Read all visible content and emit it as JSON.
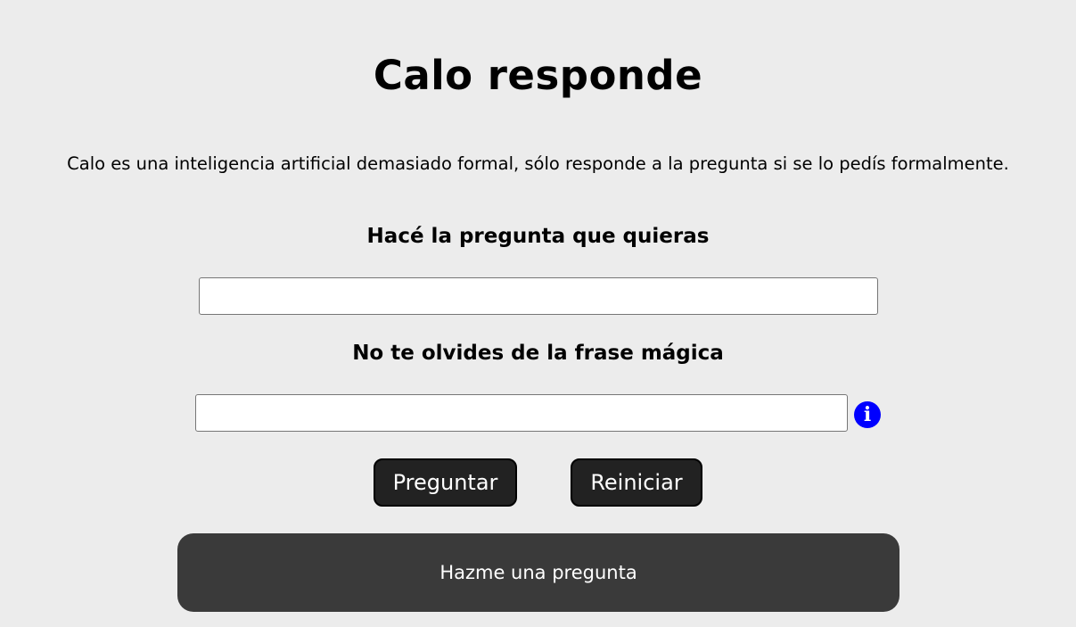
{
  "page": {
    "title": "Calo responde",
    "description": "Calo es una inteligencia artificial demasiado formal, sólo responde a la pregunta si se lo pedís formalmente."
  },
  "form": {
    "question_label": "Hacé la pregunta que quieras",
    "question_value": "",
    "question_placeholder": "",
    "magic_label": "No te olvides de la frase mágica",
    "magic_value": "",
    "magic_placeholder": "",
    "info_icon": {
      "name": "info-icon",
      "glyph": "i",
      "color": "#0000ff"
    }
  },
  "buttons": {
    "ask_label": "Preguntar",
    "reset_label": "Reiniciar"
  },
  "answer": {
    "text": "Hazme una pregunta"
  },
  "colors": {
    "background": "#ececec",
    "button": "#222222",
    "answer_box": "#3a3a3a",
    "info_icon": "#0000ff"
  }
}
